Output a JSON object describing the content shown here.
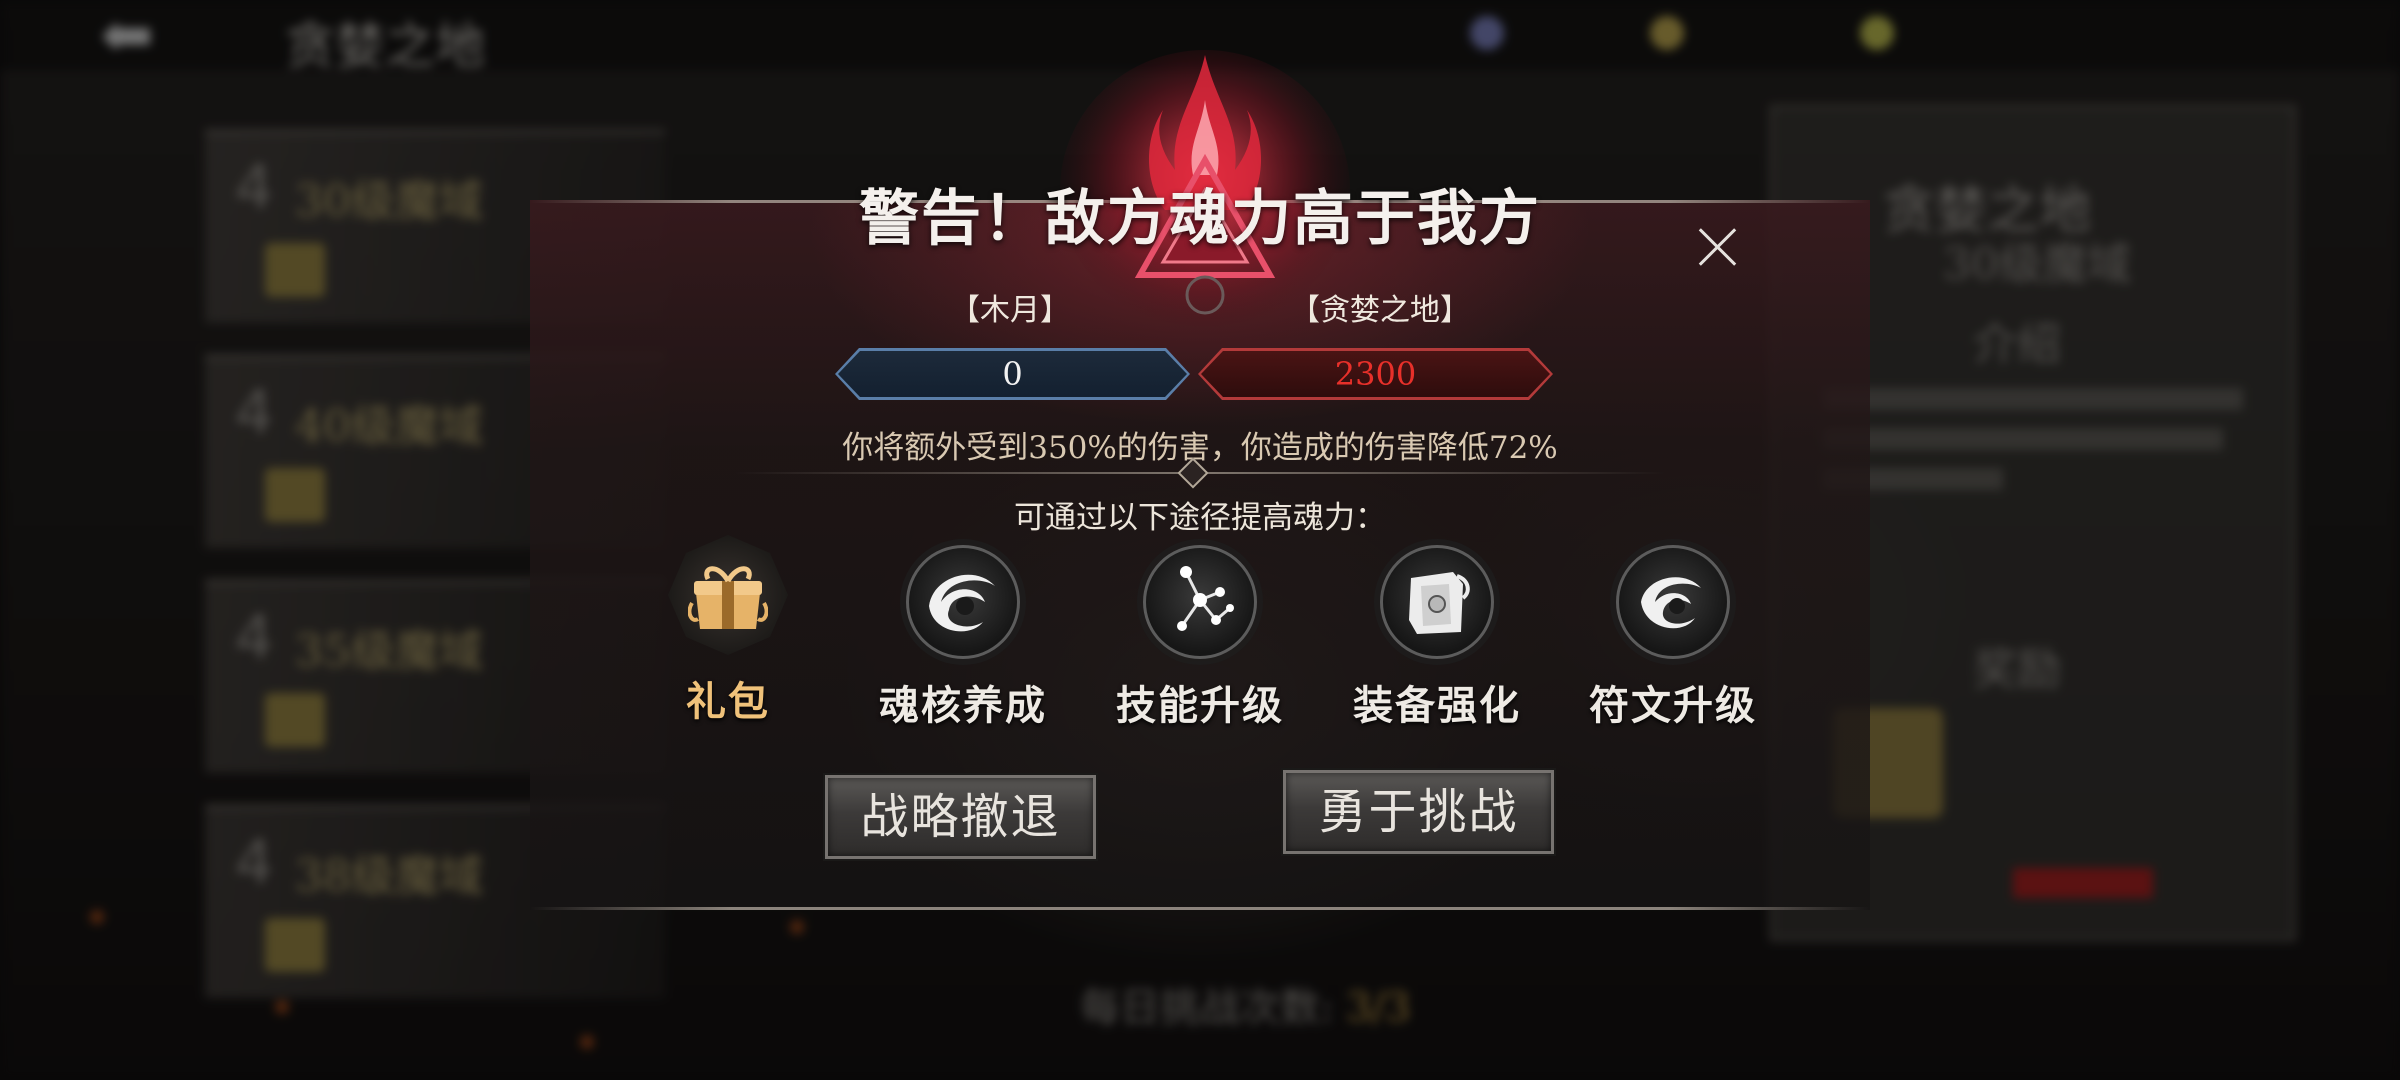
{
  "background": {
    "page_title": "贪婪之地",
    "level_rows": [
      "30级魔域",
      "40级魔域",
      "35级魔域",
      "38级魔域"
    ],
    "right_panel": {
      "title": "贪婪之地",
      "subtitle": "30级魔域",
      "heading": "介绍",
      "reward_heading": "奖励"
    },
    "bottom_text": "每日挑战次数:",
    "bottom_count": "3/3"
  },
  "dialog": {
    "title": "警告！敌方魂力高于我方",
    "left_side_name": "【木月】",
    "right_side_name": "【贪婪之地】",
    "left_power": "0",
    "right_power": "2300",
    "penalty_text": "你将额外受到350%的伤害，你造成的伤害降低72%",
    "ways_text": "可通过以下途径提高魂力：",
    "options": [
      {
        "label": "礼包",
        "icon": "gift-chest-icon"
      },
      {
        "label": "魂核养成",
        "icon": "soul-core-icon"
      },
      {
        "label": "技能升级",
        "icon": "skill-constellation-icon"
      },
      {
        "label": "装备强化",
        "icon": "equipment-icon"
      },
      {
        "label": "符文升级",
        "icon": "rune-icon"
      }
    ],
    "retreat_label": "战略撤退",
    "challenge_label": "勇于挑战"
  },
  "colors": {
    "accent_red": "#e8302a",
    "gift_gold": "#f0c27a",
    "left_power_border": "#5a7ea8",
    "right_power_border": "#b33a3a"
  }
}
